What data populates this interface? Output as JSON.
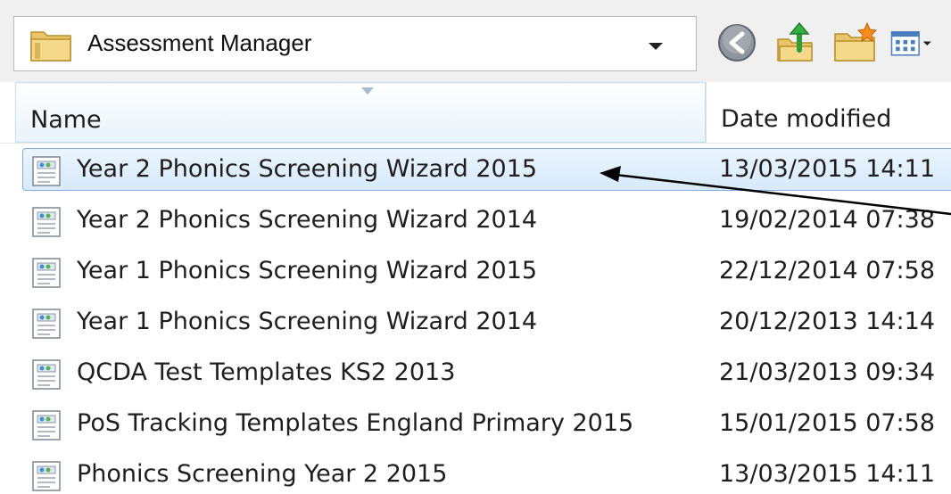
{
  "address_bar": {
    "location": "Assessment Manager",
    "folder_icon": "folder-icon",
    "dropdown_icon": "chevron-down-icon"
  },
  "toolbar": {
    "buttons": [
      {
        "name": "back-button",
        "icon": "back-arrow-icon"
      },
      {
        "name": "up-folder-button",
        "icon": "up-folder-icon"
      },
      {
        "name": "new-folder-button",
        "icon": "new-folder-icon"
      },
      {
        "name": "view-menu-button",
        "icon": "view-menu-icon"
      }
    ]
  },
  "columns": {
    "name": "Name",
    "date_modified": "Date modified"
  },
  "files": [
    {
      "name": "Year 2 Phonics Screening Wizard 2015",
      "date": "13/03/2015 14:11",
      "selected": true
    },
    {
      "name": "Year 2 Phonics Screening Wizard 2014",
      "date": "19/02/2014 07:38",
      "selected": false
    },
    {
      "name": "Year 1 Phonics Screening Wizard 2015",
      "date": "22/12/2014 07:58",
      "selected": false
    },
    {
      "name": "Year 1 Phonics Screening Wizard 2014",
      "date": "20/12/2013 14:14",
      "selected": false
    },
    {
      "name": "QCDA Test Templates KS2 2013",
      "date": "21/03/2013 09:34",
      "selected": false
    },
    {
      "name": "PoS Tracking Templates England Primary 2015",
      "date": "15/01/2015 07:58",
      "selected": false
    },
    {
      "name": "Phonics Screening Year 2 2015",
      "date": "13/03/2015 14:11",
      "selected": false
    }
  ],
  "colors": {
    "selection_border": "#84acdd",
    "selection_fill": "#d7eafb",
    "header_border": "#c2dcf1",
    "toolbar_bg": "#f0f0f0"
  }
}
